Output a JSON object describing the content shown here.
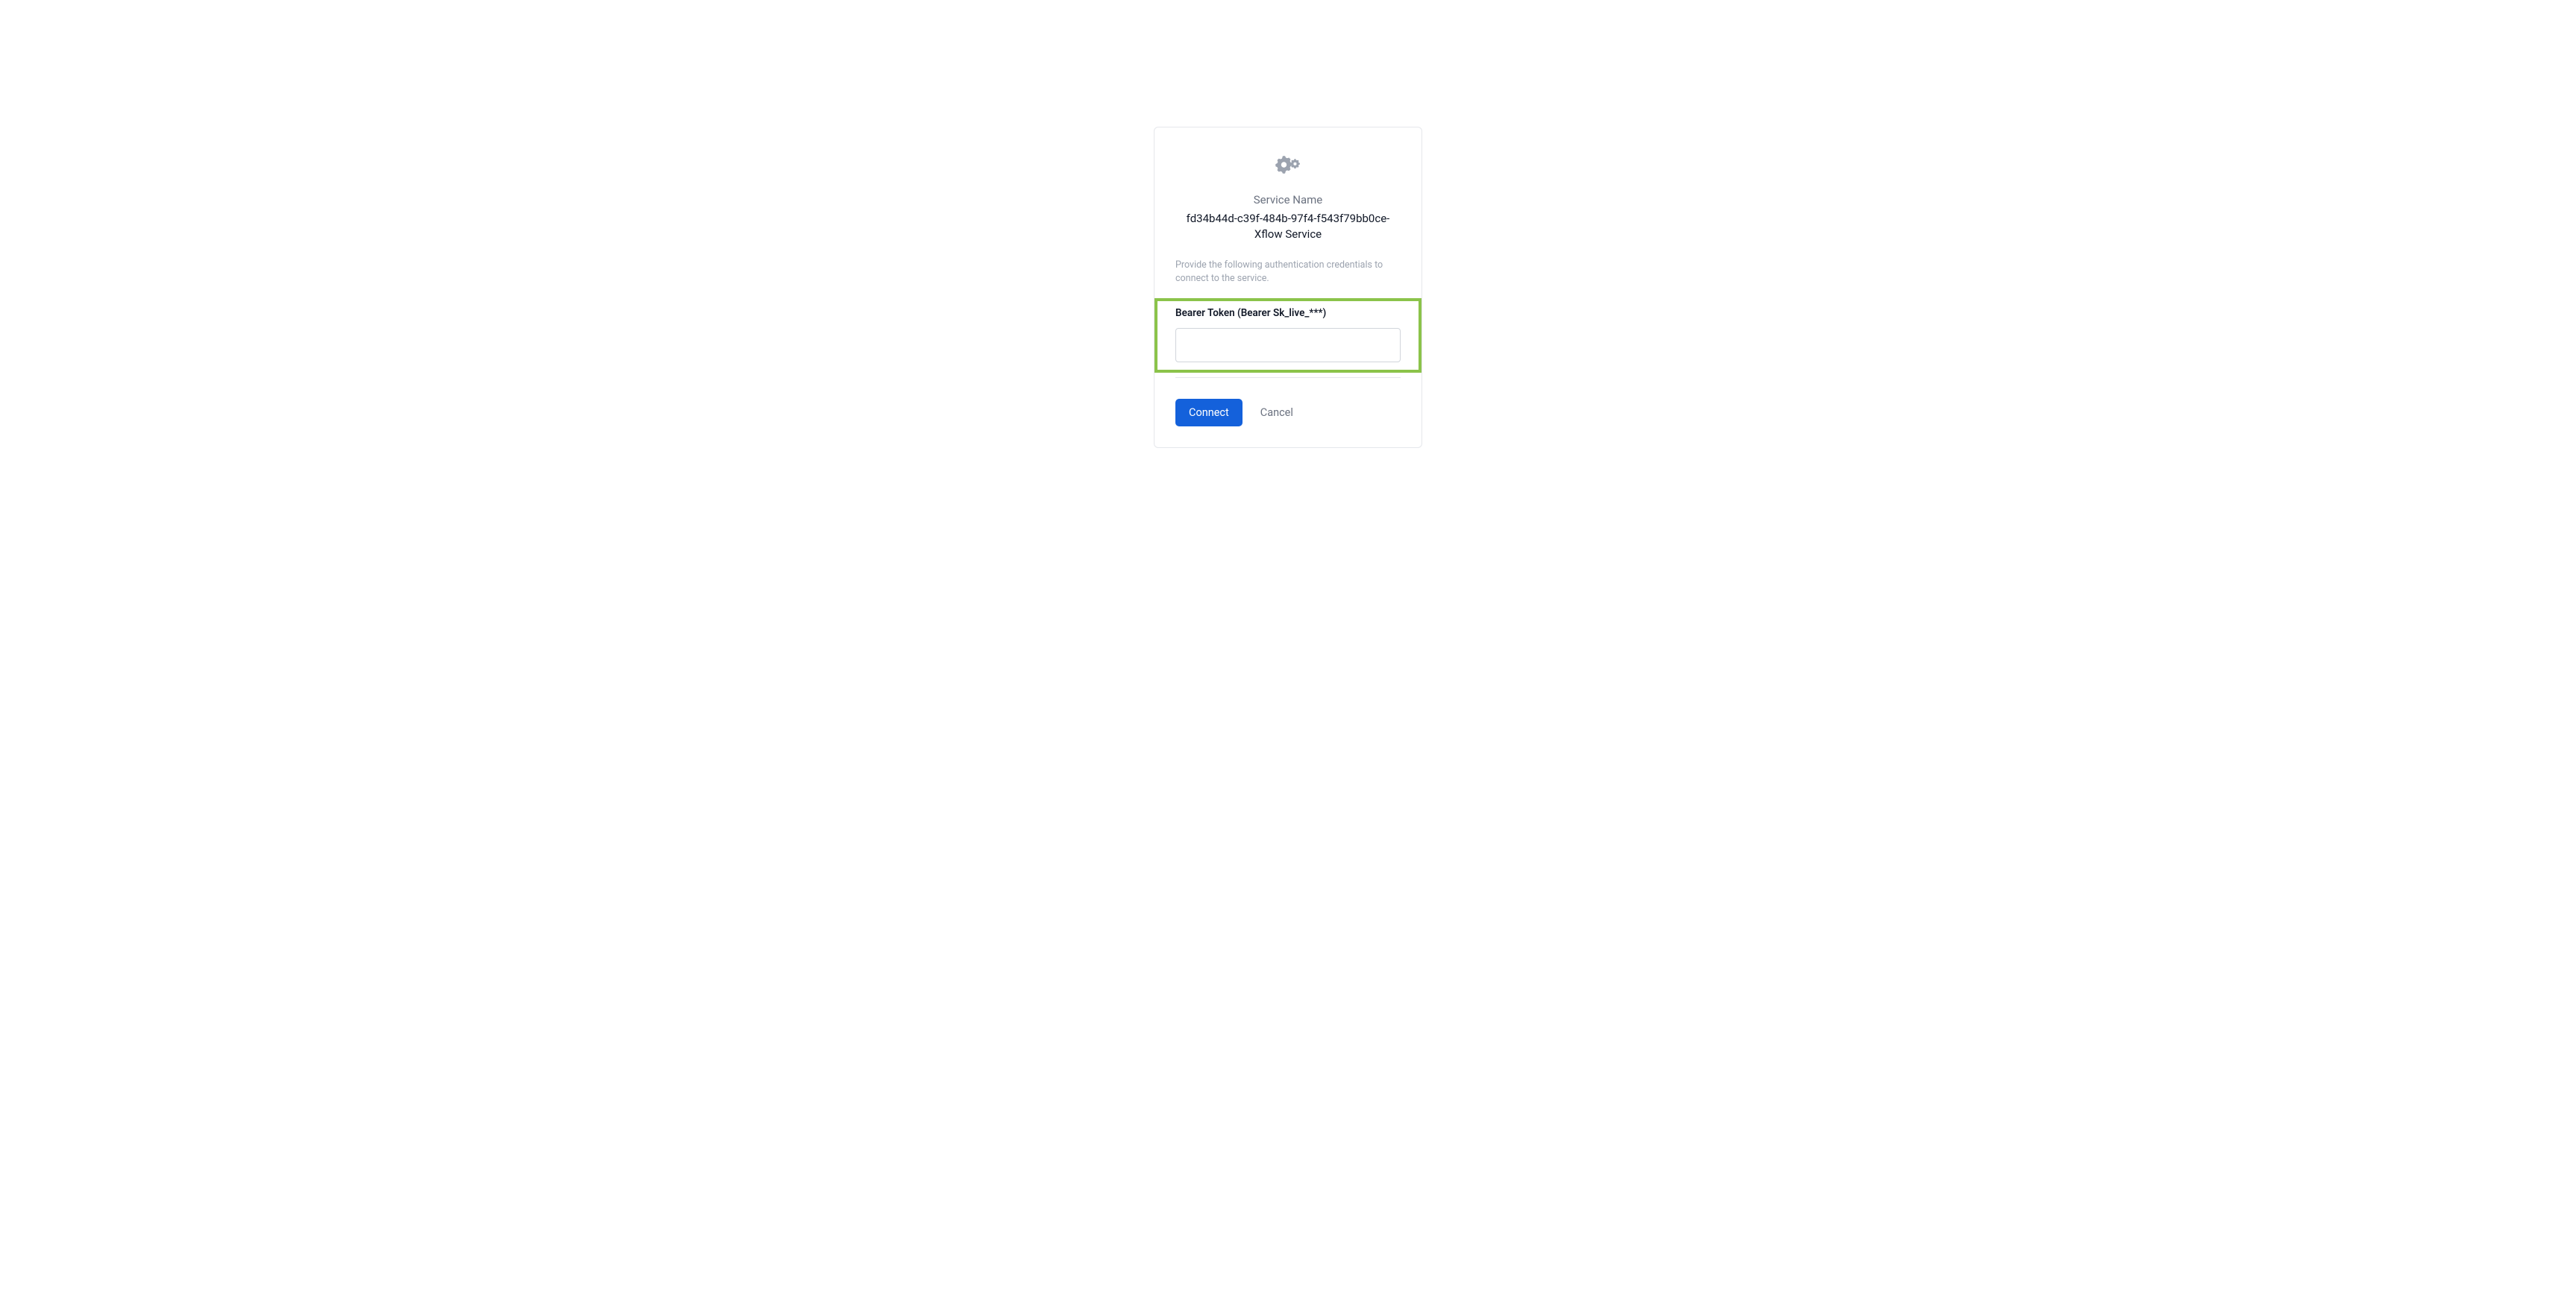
{
  "dialog": {
    "service_name_label": "Service Name",
    "service_name_value": "fd34b44d-c39f-484b-97f4-f543f79bb0ce-Xflow Service",
    "instruction": "Provide the following authentication credentials to connect to the service.",
    "field": {
      "label": "Bearer Token (Bearer Sk_live_***)",
      "value": ""
    },
    "buttons": {
      "connect": "Connect",
      "cancel": "Cancel"
    }
  }
}
